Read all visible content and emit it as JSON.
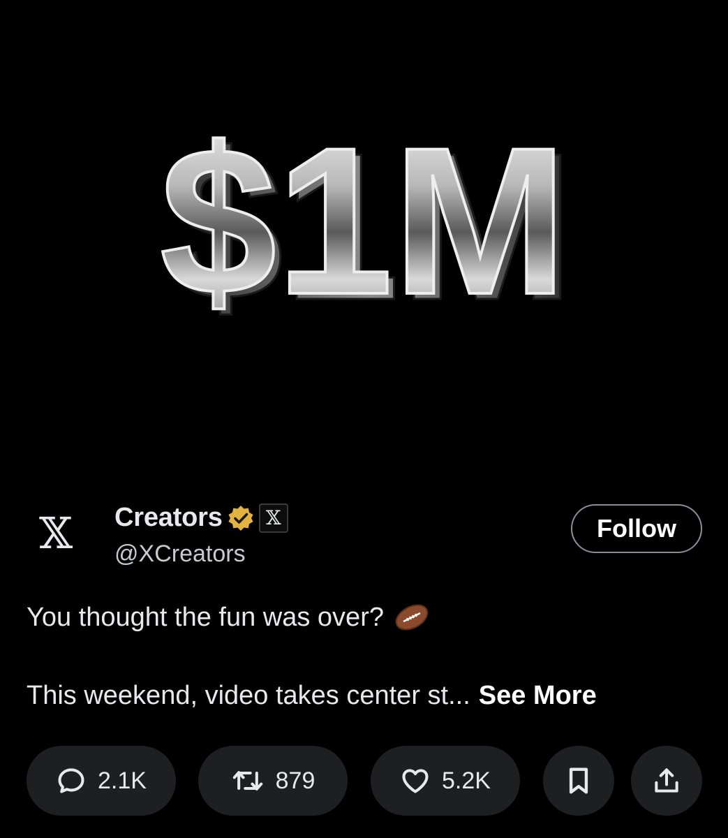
{
  "media": {
    "headline": "$1M",
    "background_color": "#000000",
    "chrome_colors": [
      "#f2f2f2",
      "#9a9a9a",
      "#3c3c3c"
    ]
  },
  "author": {
    "avatar_icon": "x-logo-icon",
    "name": "Creators",
    "verified_icon": "verified-badge-icon",
    "verified_color": "#e3b341",
    "affiliate_icon": "x-logo-icon",
    "handle": "@XCreators",
    "follow_label": "Follow"
  },
  "post": {
    "line1": "You thought the fun was over?",
    "emoji_icon": "american-football-icon",
    "line2": "This weekend, video takes center st...",
    "see_more": "See More"
  },
  "actions": {
    "reply": {
      "icon": "reply-bubble-icon",
      "count": "2.1K"
    },
    "repost": {
      "icon": "repost-icon",
      "count": "879"
    },
    "like": {
      "icon": "heart-icon",
      "count": "5.2K"
    },
    "bookmark": {
      "icon": "bookmark-icon"
    },
    "share": {
      "icon": "share-icon"
    }
  }
}
